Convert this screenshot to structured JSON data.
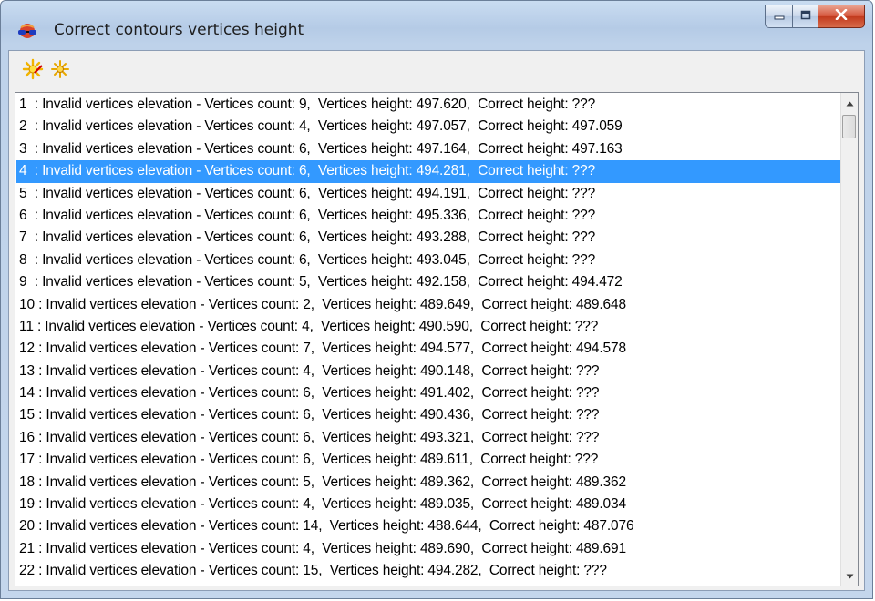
{
  "window": {
    "title": "Correct contours vertices height",
    "app_icon": "globe-glasses-icon",
    "controls": {
      "minimize_icon": "minimize-icon",
      "maximize_icon": "maximize-icon",
      "close_icon": "close-icon"
    }
  },
  "toolbar": {
    "buttons": [
      {
        "icon": "star-burst-correct-icon",
        "color": "#f2c200"
      },
      {
        "icon": "star-burst-icon",
        "color": "#e8a800"
      }
    ]
  },
  "list": {
    "selected_index": 3,
    "selection_color": "#3399ff",
    "items": [
      "1  : Invalid vertices elevation - Vertices count: 9,  Vertices height: 497.620,  Correct height: ???",
      "2  : Invalid vertices elevation - Vertices count: 4,  Vertices height: 497.057,  Correct height: 497.059",
      "3  : Invalid vertices elevation - Vertices count: 6,  Vertices height: 497.164,  Correct height: 497.163",
      "4  : Invalid vertices elevation - Vertices count: 6,  Vertices height: 494.281,  Correct height: ???",
      "5  : Invalid vertices elevation - Vertices count: 6,  Vertices height: 494.191,  Correct height: ???",
      "6  : Invalid vertices elevation - Vertices count: 6,  Vertices height: 495.336,  Correct height: ???",
      "7  : Invalid vertices elevation - Vertices count: 6,  Vertices height: 493.288,  Correct height: ???",
      "8  : Invalid vertices elevation - Vertices count: 6,  Vertices height: 493.045,  Correct height: ???",
      "9  : Invalid vertices elevation - Vertices count: 5,  Vertices height: 492.158,  Correct height: 494.472",
      "10 : Invalid vertices elevation - Vertices count: 2,  Vertices height: 489.649,  Correct height: 489.648",
      "11 : Invalid vertices elevation - Vertices count: 4,  Vertices height: 490.590,  Correct height: ???",
      "12 : Invalid vertices elevation - Vertices count: 7,  Vertices height: 494.577,  Correct height: 494.578",
      "13 : Invalid vertices elevation - Vertices count: 4,  Vertices height: 490.148,  Correct height: ???",
      "14 : Invalid vertices elevation - Vertices count: 6,  Vertices height: 491.402,  Correct height: ???",
      "15 : Invalid vertices elevation - Vertices count: 6,  Vertices height: 490.436,  Correct height: ???",
      "16 : Invalid vertices elevation - Vertices count: 6,  Vertices height: 493.321,  Correct height: ???",
      "17 : Invalid vertices elevation - Vertices count: 6,  Vertices height: 489.611,  Correct height: ???",
      "18 : Invalid vertices elevation - Vertices count: 5,  Vertices height: 489.362,  Correct height: 489.362",
      "19 : Invalid vertices elevation - Vertices count: 4,  Vertices height: 489.035,  Correct height: 489.034",
      "20 : Invalid vertices elevation - Vertices count: 14,  Vertices height: 488.644,  Correct height: 487.076",
      "21 : Invalid vertices elevation - Vertices count: 4,  Vertices height: 489.690,  Correct height: 489.691",
      "22 : Invalid vertices elevation - Vertices count: 15,  Vertices height: 494.282,  Correct height: ???"
    ]
  },
  "scrollbar": {
    "up_icon": "scroll-up-arrow-icon",
    "down_icon": "scroll-down-arrow-icon"
  }
}
